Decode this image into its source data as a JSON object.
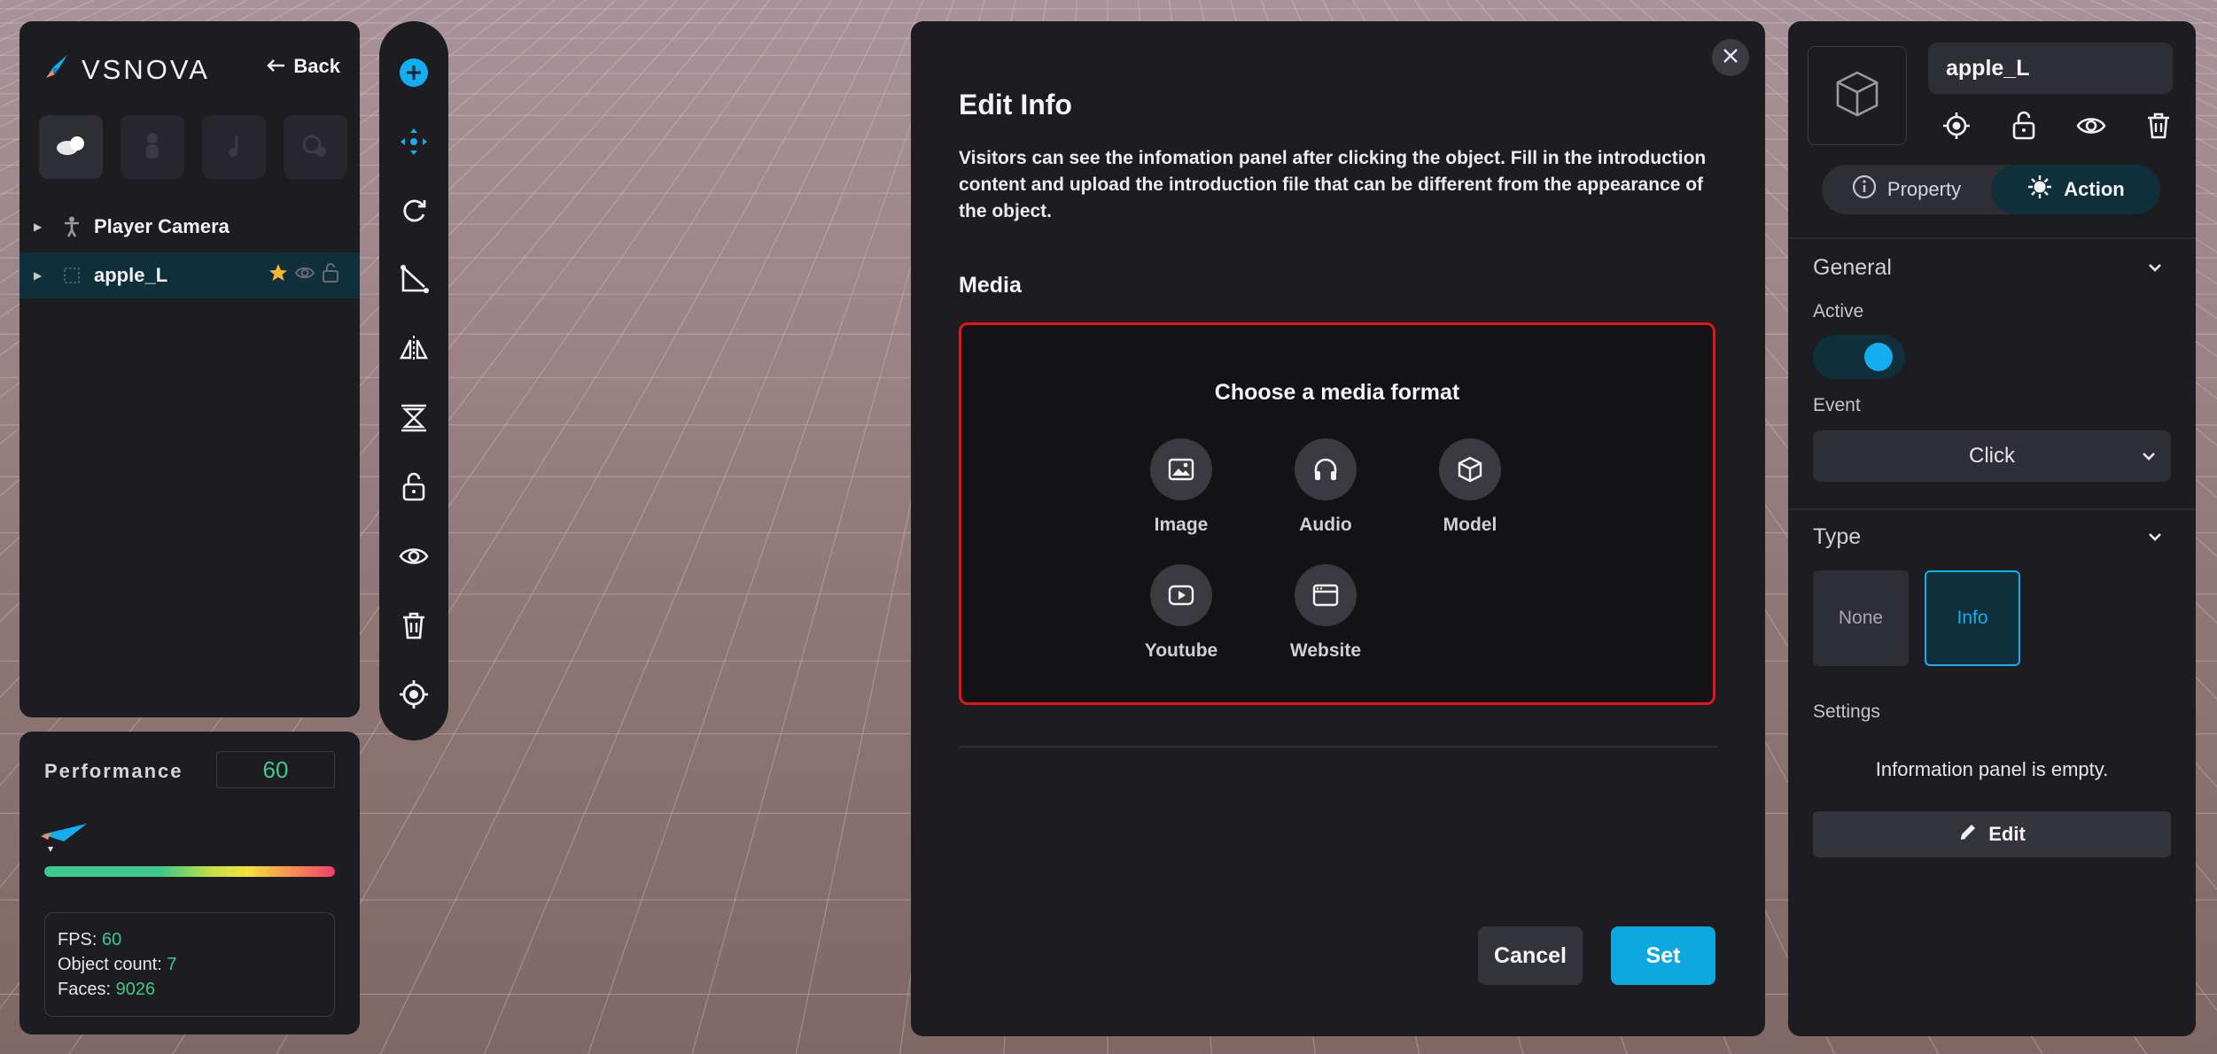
{
  "app": {
    "brand": "VSNOVA",
    "back_label": "Back"
  },
  "outliner": {
    "tools": [
      "cloud-icon",
      "person-icon",
      "music-icon",
      "effects-icon"
    ],
    "items": [
      {
        "label": "Player Camera",
        "icon": "person-icon"
      },
      {
        "label": "apple_L",
        "icon": "dotted-square-icon"
      }
    ]
  },
  "performance": {
    "title": "Performance",
    "value": "60",
    "fps_label": "FPS:",
    "fps": "60",
    "objects_label": "Object count:",
    "objects": "7",
    "faces_label": "Faces:",
    "faces": "9026"
  },
  "toolbar": [
    "add-icon",
    "move-icon",
    "rotate-icon",
    "scale-icon",
    "mirror-icon",
    "align-icon",
    "lock-icon",
    "eye-icon",
    "trash-icon",
    "focus-icon"
  ],
  "modal": {
    "title": "Edit Info",
    "description": "Visitors can see the infomation panel after clicking the object. Fill in the introduction content and upload the introduction file that can be different from the appearance of the object.",
    "media_label": "Media",
    "media_heading": "Choose a media format",
    "options": [
      {
        "label": "Image",
        "icon": "image-icon"
      },
      {
        "label": "Audio",
        "icon": "headphones-icon"
      },
      {
        "label": "Model",
        "icon": "cube-icon"
      },
      {
        "label": "Youtube",
        "icon": "play-icon"
      },
      {
        "label": "Website",
        "icon": "browser-icon"
      }
    ],
    "cancel_label": "Cancel",
    "set_label": "Set"
  },
  "inspector": {
    "object_name": "apple_L",
    "tabs": [
      {
        "label": "Property"
      },
      {
        "label": "Action"
      }
    ],
    "active_tab": "Action",
    "general_title": "General",
    "active_label": "Active",
    "active_on": true,
    "event_label": "Event",
    "event_value": "Click",
    "type_title": "Type",
    "type_none": "None",
    "type_info": "Info",
    "settings_label": "Settings",
    "empty_message": "Information panel is empty.",
    "edit_label": "Edit"
  },
  "colors": {
    "accent": "#14aef0",
    "danger": "#e0161b",
    "good": "#3ec98a",
    "panel": "#1c1c21"
  }
}
